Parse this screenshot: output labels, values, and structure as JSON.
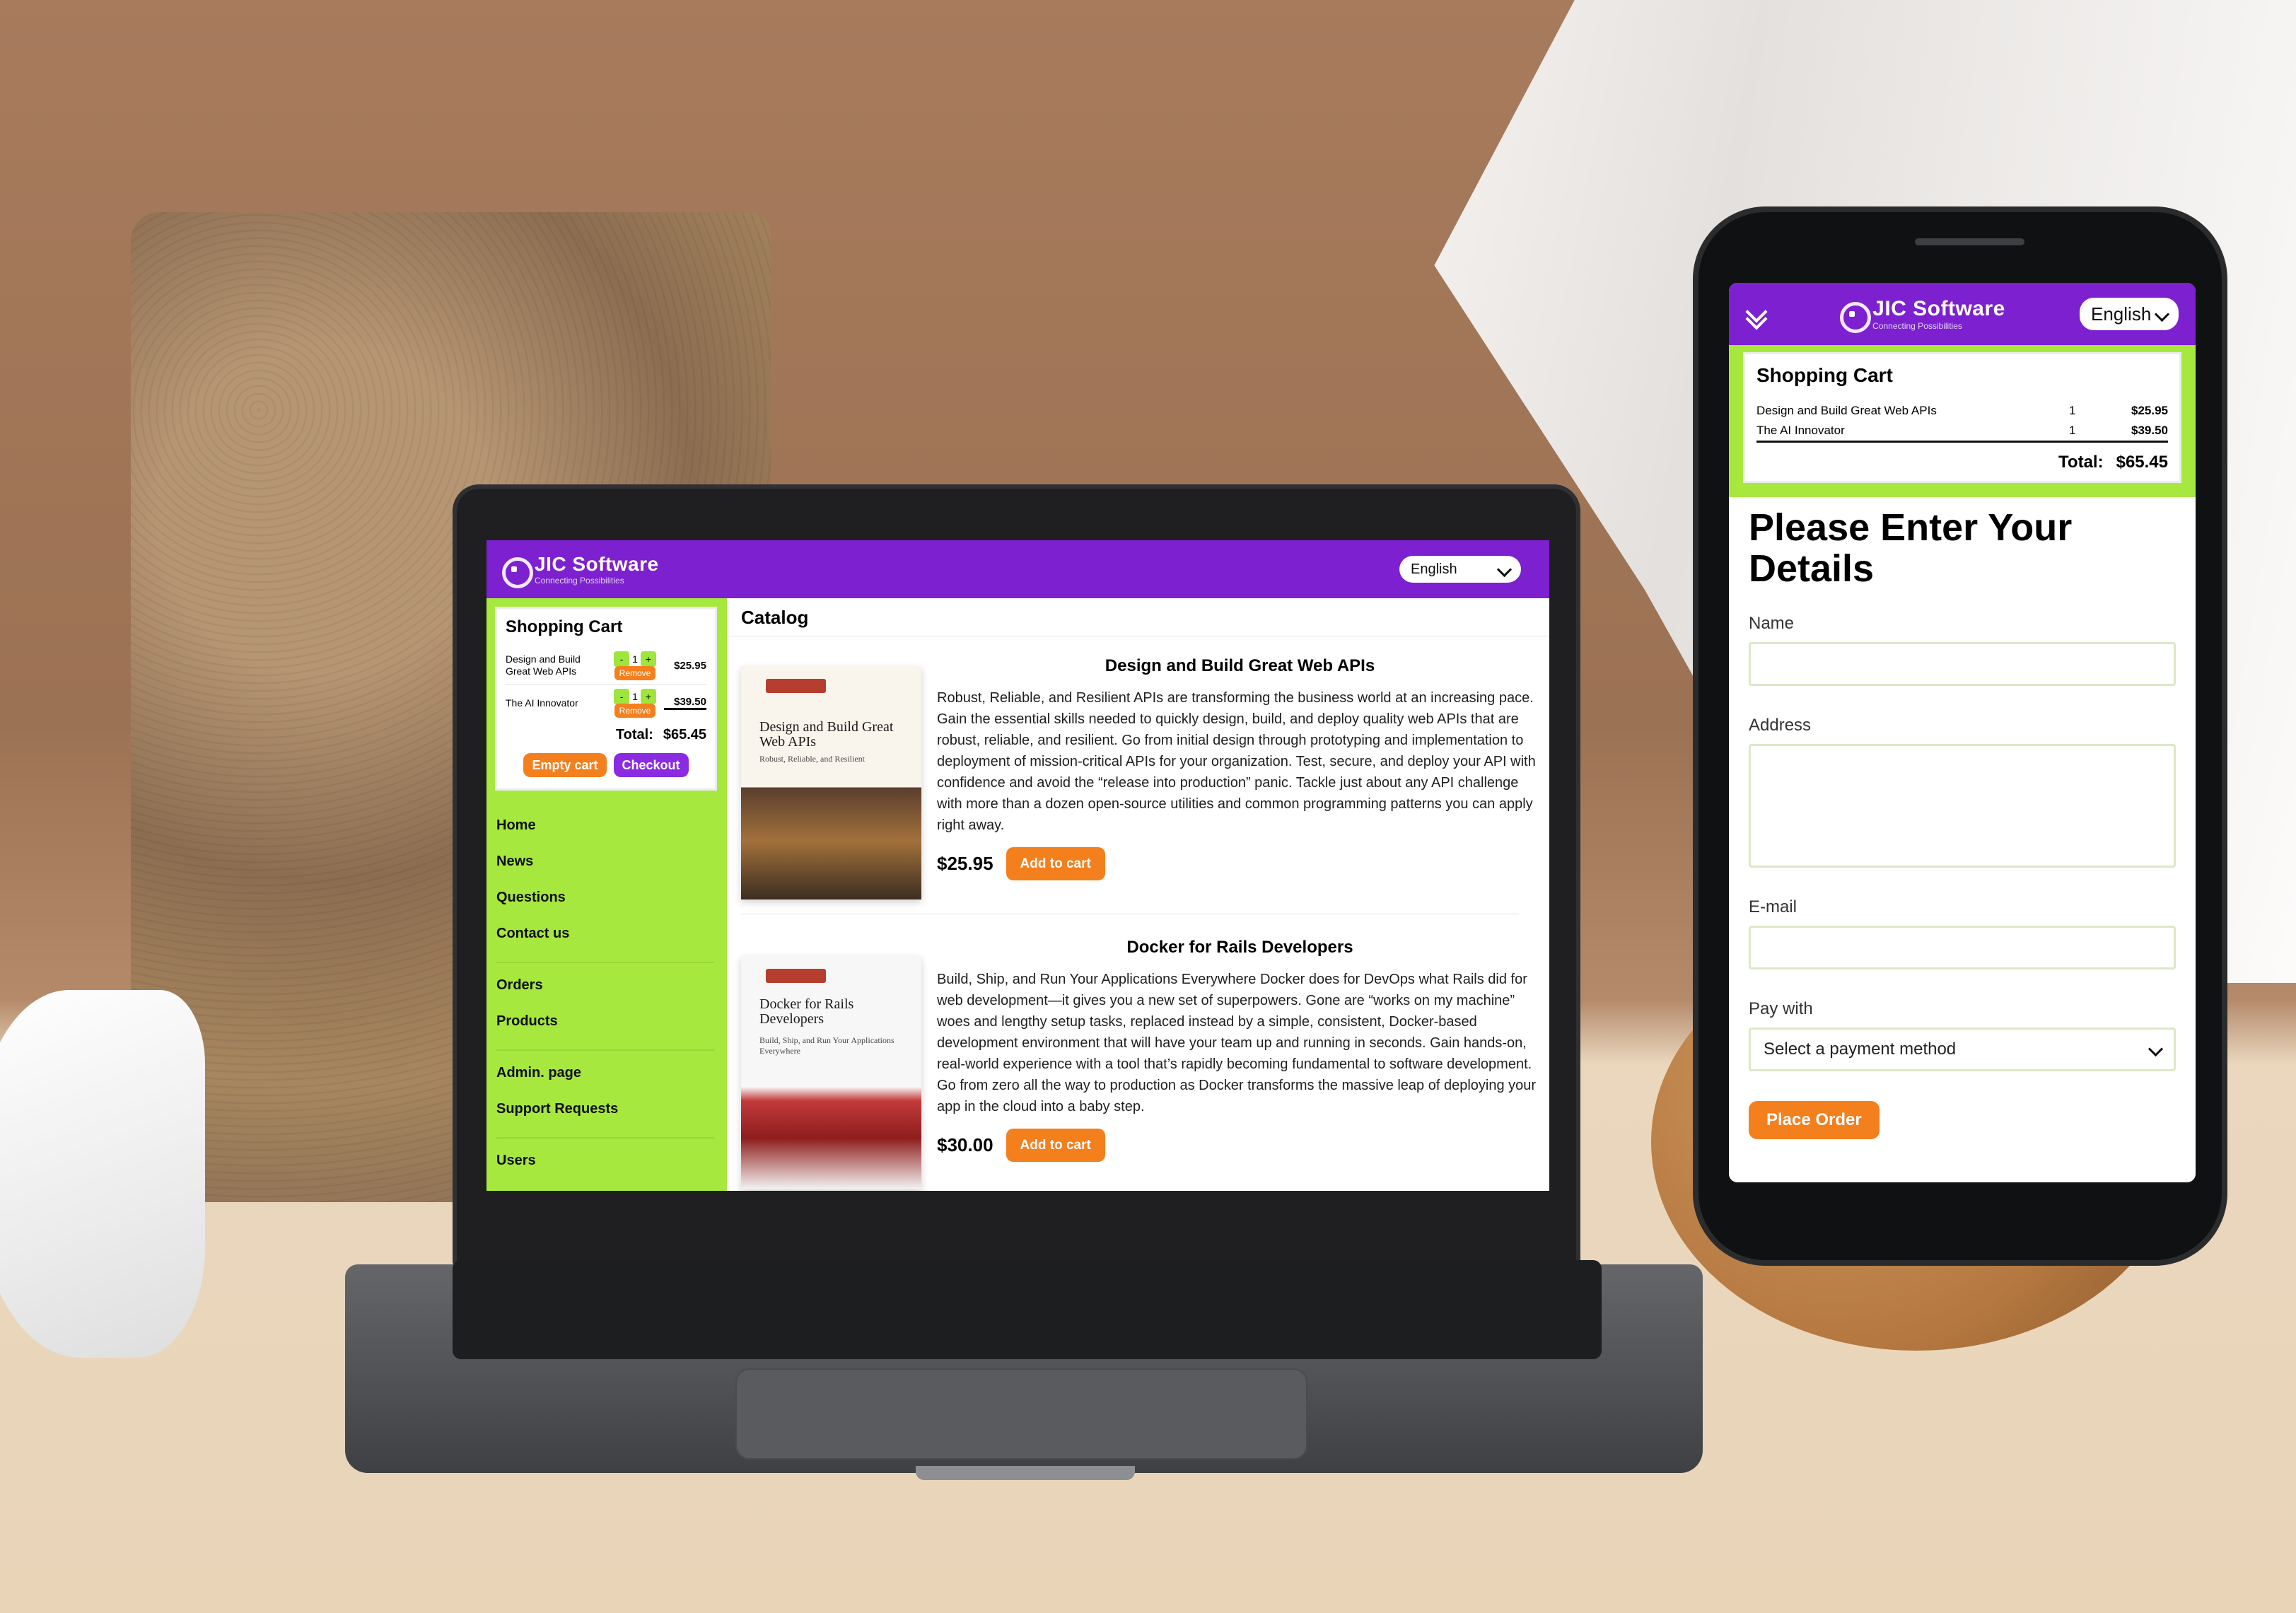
{
  "laptop": {
    "brand": "JIC Software",
    "tagline": "Connecting Possibilities",
    "language": "English",
    "cart": {
      "title": "Shopping Cart",
      "items": [
        {
          "name": "Design and Build Great Web APIs",
          "qty": "1",
          "price": "$25.95",
          "remove": "Remove"
        },
        {
          "name": "The AI Innovator",
          "qty": "1",
          "price": "$39.50",
          "remove": "Remove"
        }
      ],
      "total_label": "Total:",
      "total": "$65.45",
      "empty_label": "Empty cart",
      "checkout_label": "Checkout"
    },
    "nav": [
      "Home",
      "News",
      "Questions",
      "Contact us",
      "Orders",
      "Products",
      "Admin. page",
      "Support Requests",
      "Users"
    ],
    "catalog": {
      "title": "Catalog",
      "books": [
        {
          "title": "Design and Build Great Web APIs",
          "cover_title": "Design and Build Great Web APIs",
          "cover_subtitle": "Robust, Reliable, and Resilient",
          "description": "Robust, Reliable, and Resilient APIs are transforming the business world at an increasing pace. Gain the essential skills needed to quickly design, build, and deploy quality web APIs that are robust, reliable, and resilient. Go from initial design through prototyping and implementation to deployment of mission-critical APIs for your organization. Test, secure, and deploy your API with confidence and avoid the “release into production” panic. Tackle just about any API challenge with more than a dozen open-source utilities and common programming patterns you can apply right away.",
          "price": "$25.95",
          "button": "Add to cart"
        },
        {
          "title": "Docker for Rails Developers",
          "cover_title": "Docker for Rails Developers",
          "cover_subtitle": "Build, Ship, and Run Your Applications Everywhere",
          "description": "Build, Ship, and Run Your Applications Everywhere Docker does for DevOps what Rails did for web development—it gives you a new set of superpowers. Gone are “works on my machine” woes and lengthy setup tasks, replaced instead by a simple, consistent, Docker-based development environment that will have your team up and running in seconds. Gain hands-on, real-world experience with a tool that’s rapidly becoming fundamental to software development. Go from zero all the way to production as Docker transforms the massive leap of deploying your app in the cloud into a baby step.",
          "price": "$30.00",
          "button": "Add to cart"
        }
      ]
    }
  },
  "phone": {
    "brand": "JIC Software",
    "tagline": "Connecting Possibilities",
    "language": "English",
    "cart": {
      "title": "Shopping Cart",
      "items": [
        {
          "name": "Design and Build Great Web APIs",
          "qty": "1",
          "price": "$25.95"
        },
        {
          "name": "The AI Innovator",
          "qty": "1",
          "price": "$39.50"
        }
      ],
      "total_label": "Total:",
      "total": "$65.45"
    },
    "form": {
      "title": "Please Enter Your Details",
      "name_label": "Name",
      "address_label": "Address",
      "email_label": "E-mail",
      "pay_label": "Pay with",
      "pay_placeholder": "Select a payment method",
      "submit": "Place Order"
    }
  }
}
